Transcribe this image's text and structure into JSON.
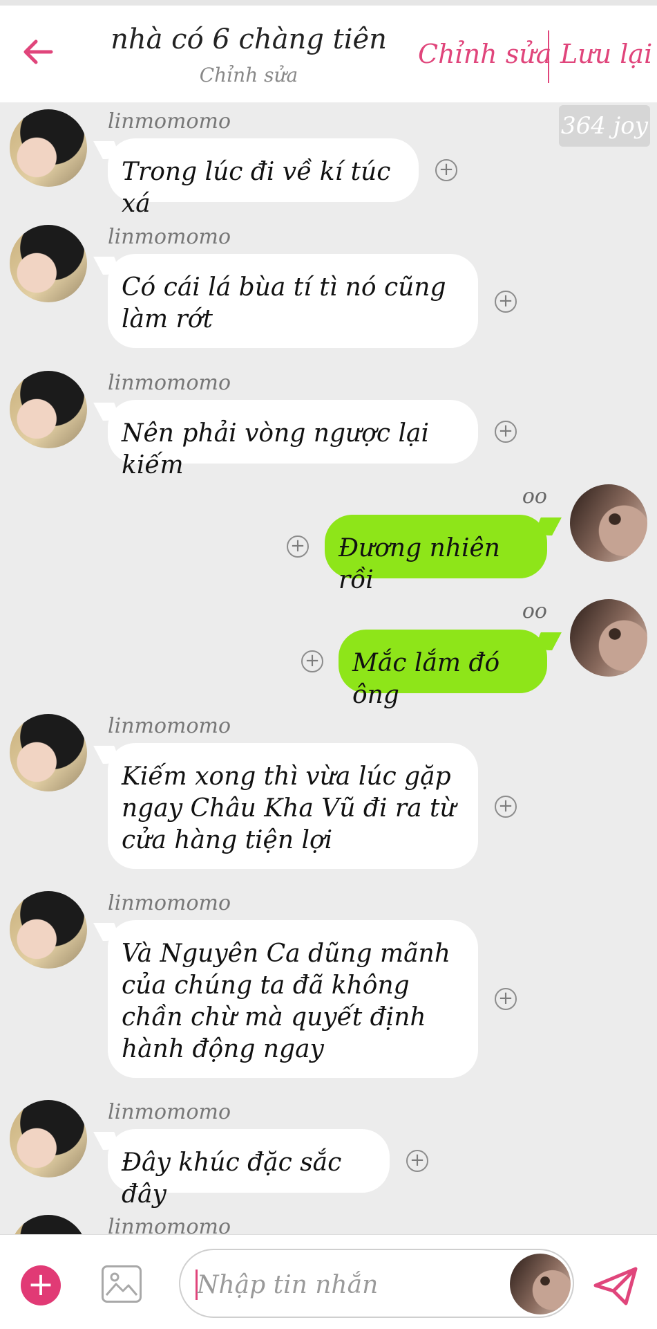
{
  "header": {
    "title": "nhà có 6 chàng tiên",
    "subtitle": "Chỉnh sửa",
    "edit_label": "Chỉnh sửa",
    "save_label": "Lưu lại"
  },
  "badge": "364 joy",
  "messages": [
    {
      "sender": "linmomomo",
      "text": "Trong lúc đi về kí túc xá"
    },
    {
      "sender": "linmomomo",
      "text": "Có cái lá bùa tí tì nó cũng làm rớt"
    },
    {
      "sender": "linmomomo",
      "text": "Nên phải vòng ngược lại kiếm"
    },
    {
      "sender": "oo",
      "text": "Đương nhiên rồi"
    },
    {
      "sender": "oo",
      "text": "Mắc lắm đó ông"
    },
    {
      "sender": "linmomomo",
      "text": "Kiếm xong thì vừa lúc gặp ngay Châu Kha Vũ đi ra từ cửa hàng tiện lợi"
    },
    {
      "sender": "linmomomo",
      "text": "Và Nguyên Ca dũng mãnh của chúng ta đã không chần chừ mà quyết định hành động ngay"
    },
    {
      "sender": "linmomomo",
      "text": "Đây khúc đặc sắc đây"
    },
    {
      "sender": "linmomomo",
      "text": ""
    }
  ],
  "composer": {
    "placeholder": "Nhập tin nhắn"
  },
  "icons": {
    "back": "arrow-left-icon",
    "add": "plus-circle-icon",
    "image": "image-icon",
    "send": "send-icon"
  },
  "colors": {
    "accent": "#e0457b",
    "outgoing_bubble": "#8ee519",
    "incoming_bubble": "#ffffff",
    "background": "#ececec"
  }
}
